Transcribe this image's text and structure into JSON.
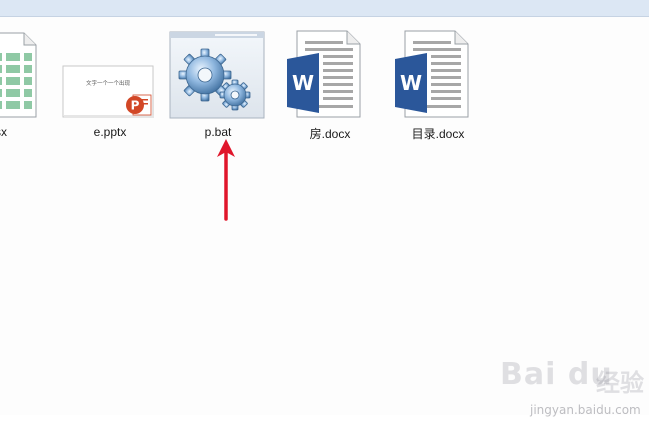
{
  "files": [
    {
      "label": "tlsx",
      "type": "excel",
      "icon": "excel-sheet-icon"
    },
    {
      "label": "e.pptx",
      "type": "powerpoint",
      "icon": "powerpoint-icon",
      "thumb_text": "文字一个一个出现"
    },
    {
      "label": "p.bat",
      "type": "batch",
      "icon": "gears-icon"
    },
    {
      "label": "房.docx",
      "type": "word",
      "icon": "word-doc-icon",
      "word_letter": "W"
    },
    {
      "label": "目录.docx",
      "type": "word",
      "icon": "word-doc-icon",
      "word_letter": "W"
    }
  ],
  "ppt_letter": "P",
  "colors": {
    "word_blue": "#2b579a",
    "ppt_orange": "#d24726",
    "excel_green": "#8fc9a5",
    "arrow_red": "#e0162b",
    "topbar": "#dce7f4"
  },
  "watermark": {
    "logo": "Bai du",
    "cn_text": "经验",
    "url": "jingyan.baidu.com"
  }
}
